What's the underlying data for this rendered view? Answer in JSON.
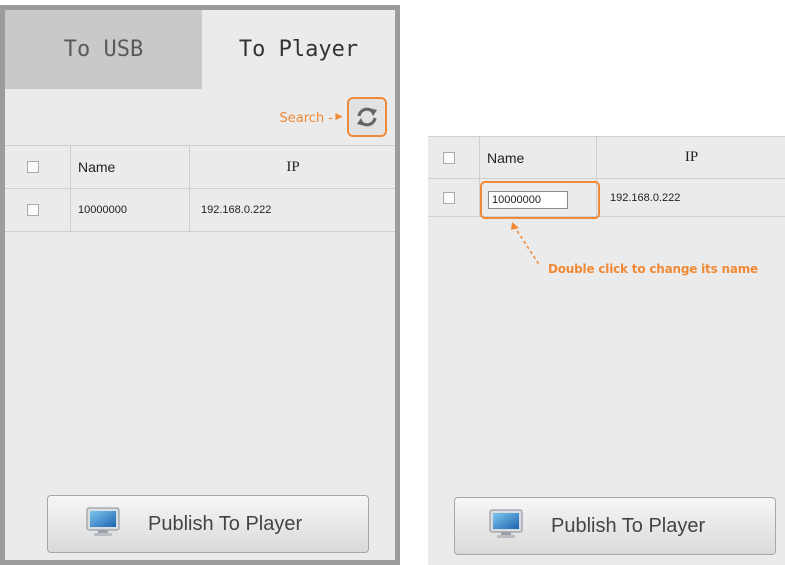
{
  "left_panel": {
    "tabs": [
      {
        "label": "To USB",
        "active": false
      },
      {
        "label": "To Player",
        "active": true
      }
    ],
    "search": {
      "annotation": "Search",
      "icon": "refresh-icon"
    },
    "table": {
      "headers": {
        "name": "Name",
        "ip": "IP"
      },
      "rows": [
        {
          "name": "10000000",
          "ip": "192.168.0.222"
        }
      ]
    },
    "publish_button": {
      "label": "Publish To Player",
      "icon": "monitor-icon"
    }
  },
  "right_panel": {
    "table": {
      "headers": {
        "name": "Name",
        "ip": "IP"
      },
      "rows": [
        {
          "name_input_value": "10000000",
          "ip": "192.168.0.222"
        }
      ]
    },
    "annotation": "Double click to change its name",
    "publish_button": {
      "label": "Publish To Player",
      "icon": "monitor-icon"
    }
  },
  "colors": {
    "accent_orange": "#ef8a3a",
    "panel_bg": "#ebebeb",
    "inactive_tab": "#c9c9c9",
    "frame": "#9c9c9c"
  }
}
